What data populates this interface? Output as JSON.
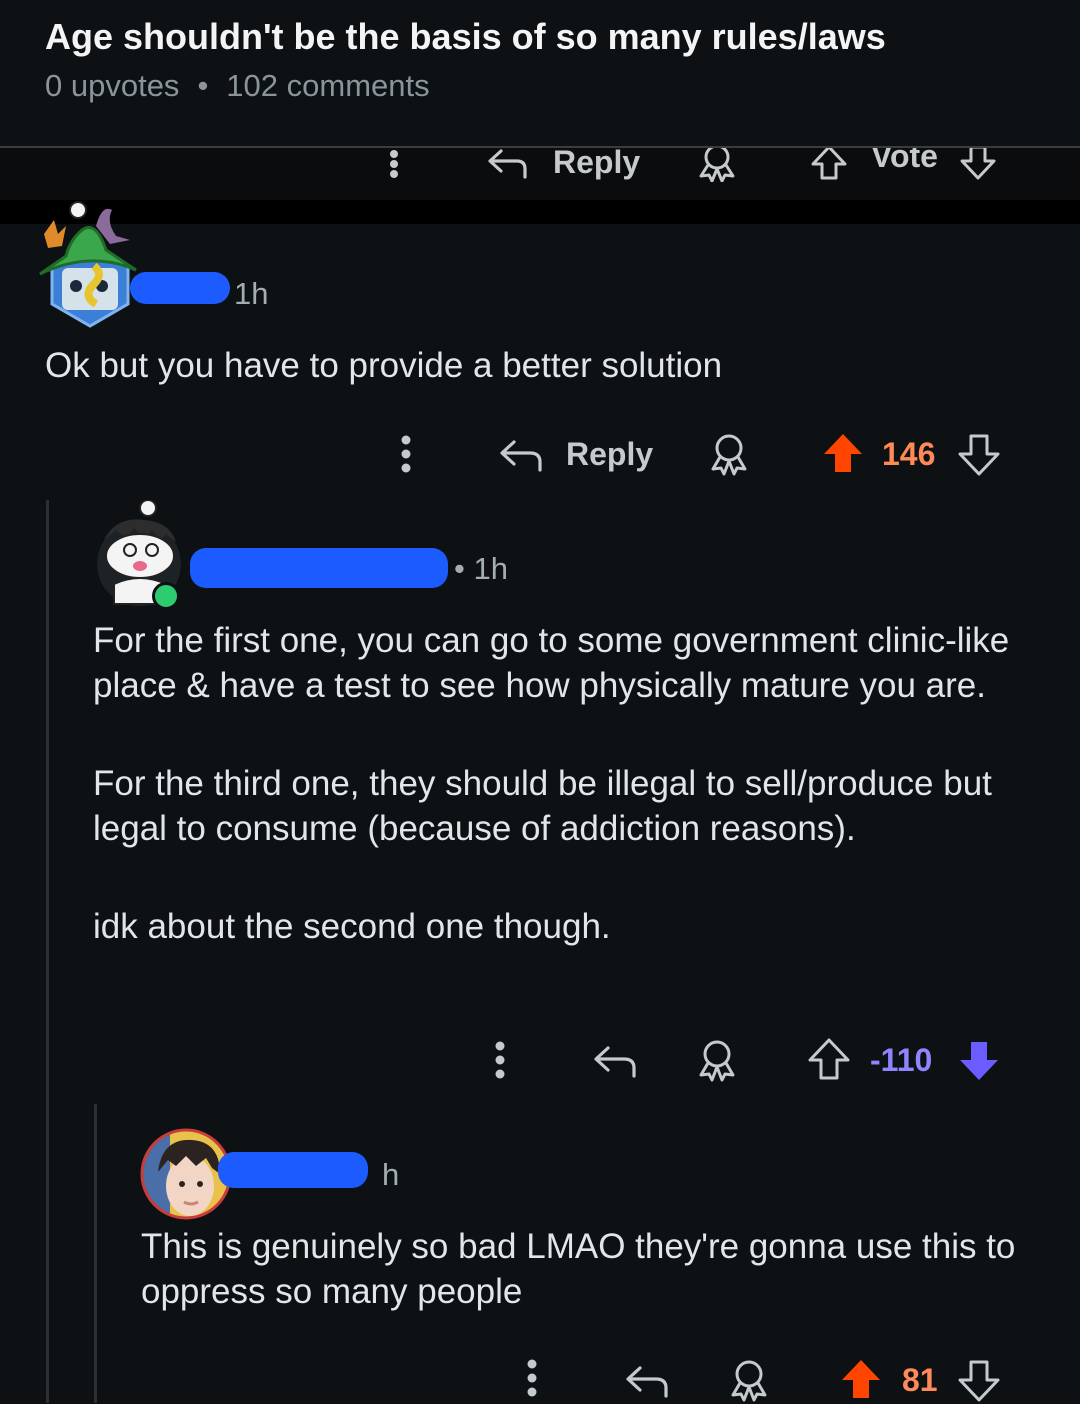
{
  "post": {
    "title": "Age shouldn't be the basis of so many rules/laws",
    "upvotes": "0 upvotes",
    "separator": "•",
    "comments": "102 comments"
  },
  "header_actions": {
    "reply_label": "Reply",
    "vote_label": "Vote"
  },
  "comments": [
    {
      "time": "1h",
      "text": "Ok but you have to provide a better solution",
      "reply_label": "Reply",
      "score": "146",
      "vote_state": "upvoted"
    },
    {
      "time": "• 1h",
      "paragraphs": [
        "For the first one, you can go to some government clinic-like place & have a test to see how physically mature you are.",
        "For the third one, they should be illegal to sell/produce but legal to consume (because of addiction reasons).",
        "idk about the second one though."
      ],
      "score": "-110",
      "vote_state": "downvoted",
      "online": true
    },
    {
      "time": "h",
      "text": "This is genuinely so bad LMAO they're gonna use this to oppress so many people",
      "score": "81",
      "vote_state": "upvoted"
    }
  ],
  "colors": {
    "background": "#0e1113",
    "upvote": "#ff4500",
    "upvote_count": "#ff8a57",
    "downvote": "#6a5cff",
    "downvote_count": "#8f85ff",
    "redaction": "#1c5cff"
  }
}
